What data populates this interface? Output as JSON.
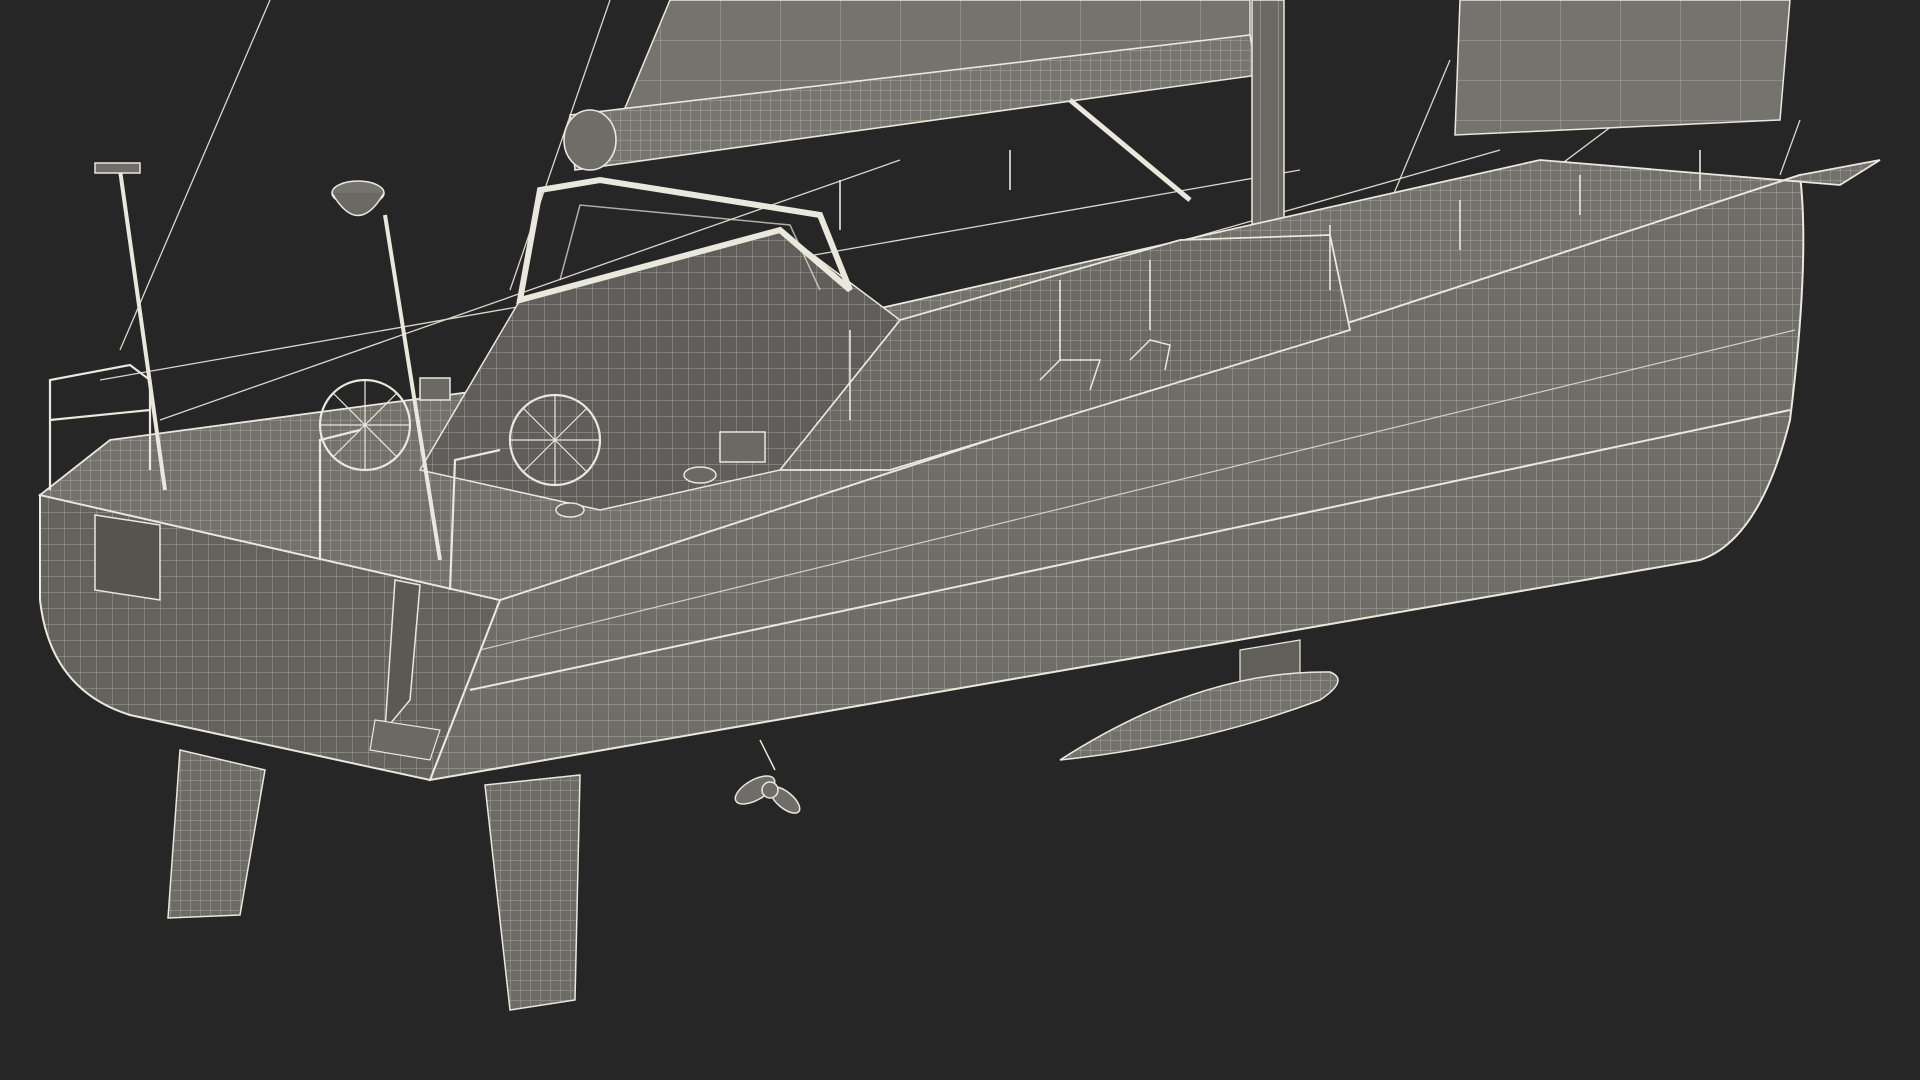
{
  "scene": {
    "subject": "sailboat-wireframe-render",
    "background_color": "#262626",
    "hull_fill_color": "#6e6d68",
    "hull_dark_color": "#5f5e5a",
    "wire_color": "#e9e8dd",
    "sail_color": "#74736d"
  },
  "icons": {
    "propeller": "propeller-icon",
    "steering_wheel": "steering-wheel-icon",
    "radar_dome": "radar-dome-icon",
    "antenna": "antenna-icon"
  }
}
